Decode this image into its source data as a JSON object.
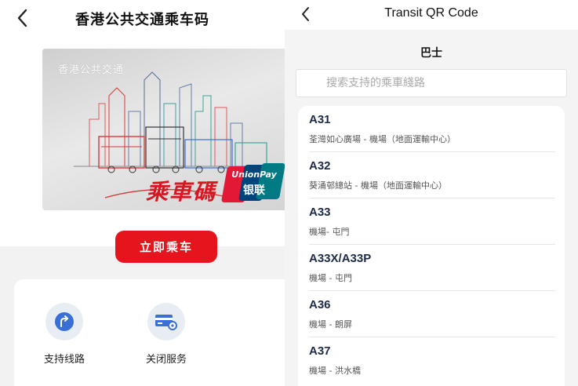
{
  "left": {
    "title": "香港公共交通乘车码",
    "card": {
      "top_text": "香港公共交通",
      "brand_text": "乘車碼",
      "unionpay_en": "UnionPay",
      "unionpay_cn": "银联"
    },
    "ride_button": "立即乘车",
    "services": [
      {
        "label": "支持线路",
        "icon": "route-icon"
      },
      {
        "label": "关闭服务",
        "icon": "card-settings-icon"
      }
    ]
  },
  "right": {
    "title": "Transit QR Code",
    "section": "巴士",
    "search_placeholder": "搜索支持的乘車綫路",
    "routes": [
      {
        "code": "A31",
        "desc": "荃灣如心廣場 - 機場（地面運輸中心）"
      },
      {
        "code": "A32",
        "desc": "葵涌邨總站 - 機場（地面運輸中心）"
      },
      {
        "code": "A33",
        "desc": "機場- 屯門"
      },
      {
        "code": "A33X/A33P",
        "desc": "機場 - 屯門"
      },
      {
        "code": "A36",
        "desc": "機場 - 朗屏"
      },
      {
        "code": "A37",
        "desc": "機場 - 洪水橋"
      }
    ]
  },
  "colors": {
    "accent_red": "#e6141c",
    "route_code": "#1d2a44",
    "icon_blue": "#3a6fd8",
    "icon_bg": "#e8edf4"
  }
}
